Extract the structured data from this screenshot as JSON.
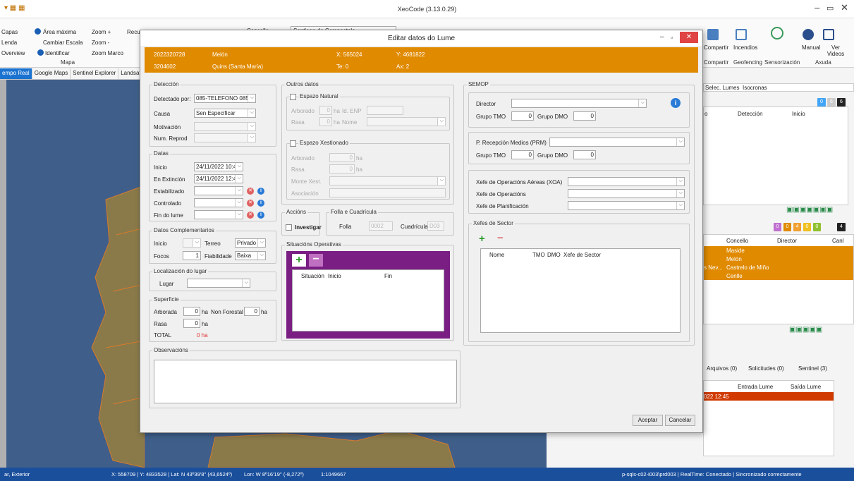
{
  "app": {
    "title": "XeoCode (3.13.0.29)"
  },
  "ribbon": {
    "capas": "Capas",
    "lenda": "Lenda",
    "overview": "Overview",
    "area_maxima": "Área máxima",
    "cambiar_escala": "Cambiar Escala",
    "identificar": "Identificar",
    "zoom_plus": "Zoom +",
    "zoom_minus": "Zoom -",
    "zoom_marco": "Zoom Marco",
    "recursos": "Recursos",
    "mapa": "Mapa",
    "concello_label": "Concello",
    "concello_value": "Santiago de Compostela",
    "compartir": "Compartir",
    "incendios": "Incendios",
    "manual": "Manual",
    "ver_videos": "Ver Videos",
    "grp_compartir": "Compartir",
    "grp_geofencing": "Geofencing",
    "grp_sensorizacion": "Sensorización",
    "grp_axuda": "Axuda"
  },
  "map_tabs": [
    "empo Real",
    "Google Maps",
    "Sentinel Explorer",
    "Landsat Ex"
  ],
  "right_pane": {
    "tabs": [
      "Selec. Lumes",
      "Isocronas"
    ],
    "top_headers": [
      "o",
      "Detección",
      "Inicio"
    ],
    "top_counts": [
      "0",
      "6",
      "6"
    ],
    "mid_counts": [
      "0",
      "0",
      "4",
      "0",
      "0",
      "4"
    ],
    "mid_headers": [
      "Concello",
      "Director",
      "Canl"
    ],
    "rows": [
      [
        "",
        "Maside"
      ],
      [
        "",
        "Melón"
      ],
      [
        "s Nev...",
        "Castrelo de Miño"
      ],
      [
        "",
        "Cenlle"
      ]
    ],
    "bottom_tabs": [
      "Arquivos (0)",
      "Solicitudes (0)",
      "Sentinel (3)"
    ],
    "bottom_headers": [
      "Entrada Lume",
      "Saída Lume"
    ],
    "bottom_row": [
      "022 12:45",
      "",
      ""
    ]
  },
  "status": {
    "left": "ar, Exterior",
    "coords": "X: 558709 | Y: 4833528 | Lat: N 43º39'8'' (43,6524º)",
    "lon": "Lon: W 8º16'19'' (-8,272º)",
    "scale": "1:1049667",
    "right": "p-sqls-c02-i003\\prd003 | RealTime: Conectado | Sincronizado correctamente"
  },
  "dialog": {
    "title": "Editar datos do Lume",
    "header": {
      "id1": "2022320728",
      "name": "Melón",
      "x": "X: 565024",
      "y": "Y: 4681822",
      "id2": "3204602",
      "place": "Quins (Santa María)",
      "te": "Te: 0",
      "ax": "Ax: 2"
    },
    "deteccion": {
      "title": "Detección",
      "detectado_label": "Detectado por:",
      "detectado_value": "085-TELEFONO 085",
      "causa_label": "Causa",
      "causa_value": "Sen Especificar",
      "motivacion_label": "Motivación",
      "num_reprod_label": "Num. Reprod"
    },
    "datas": {
      "title": "Datas",
      "inicio_label": "Inicio",
      "inicio_value": "24/11/2022 10:45",
      "extincion_label": "En Extinción",
      "extincion_value": "24/11/2022 12:46",
      "estabilizado_label": "Estabilizado",
      "controlado_label": "Controlado",
      "fin_label": "Fin do lume"
    },
    "complementarios": {
      "title": "Datos Complementarios",
      "inicio_label": "Inicio",
      "terreo_label": "Terreo",
      "terreo_value": "Privado",
      "focos_label": "Focos",
      "focos_value": "1",
      "fiabilidade_label": "Fiabilidade",
      "fiabilidade_value": "Baixa"
    },
    "localizacion": {
      "title": "Localización do lugar",
      "lugar_label": "Lugar"
    },
    "superficie": {
      "title": "Superficie",
      "arborada_label": "Arborada",
      "arborada_value": "0",
      "ha1": "ha",
      "non_forestal_label": "Non Forestal",
      "non_forestal_value": "0",
      "ha2": "ha",
      "rasa_label": "Rasa",
      "rasa_value": "0",
      "ha3": "ha",
      "total_label": "TOTAL",
      "total_value": "0 ha"
    },
    "observacions": {
      "title": "Observacións"
    },
    "outros": {
      "title": "Outros datos",
      "espazo_natural": "Espazo Natural",
      "arborado_label": "Arborado",
      "arborado_value": "0",
      "ha": "ha",
      "id_enp": "Id. ENP",
      "rasa_label": "Rasa",
      "rasa_value": "0",
      "nome_label": "Nome",
      "espazo_xestionado": "Espazo Xestionado",
      "x_arborado_label": "Arborado",
      "x_arborado_value": "0",
      "x_rasa_label": "Rasa",
      "x_rasa_value": "0",
      "monte_label": "Monte Xest.",
      "asociacion_label": "Asociación"
    },
    "accions": {
      "title": "Accións",
      "investigar": "Investigar"
    },
    "folla": {
      "title": "Folla e Cuadrícula",
      "folla_label": "Folla",
      "folla_value": "0002",
      "cuadricula_label": "Cuadrícula",
      "cuadricula_value": "D03"
    },
    "situacions": {
      "title": "Situacións Operativas",
      "cols": [
        "Situación",
        "Inicio",
        "Fin"
      ]
    },
    "semop": {
      "title": "SEMOP",
      "director_label": "Director",
      "grupo_tmo_label": "Grupo TMO",
      "grupo_tmo_value": "0",
      "grupo_dmo_label": "Grupo DMO",
      "grupo_dmo_value": "0",
      "prm_label": "P. Recepción Medios (PRM)",
      "prm_tmo_label": "Grupo TMO",
      "prm_tmo_value": "0",
      "prm_dmo_label": "Grupo DMO",
      "prm_dmo_value": "0",
      "xoa_label": "Xefe de Operacións Aéreas (XOA)",
      "xefe_op_label": "Xefe de Operacións",
      "xefe_plan_label": "Xefe de Planificación"
    },
    "sector": {
      "title": "Xefes de Sector",
      "cols": [
        "Nome",
        "TMO",
        "DMO",
        "Xefe de Sector"
      ]
    },
    "aceptar": "Aceptar",
    "cancelar": "Cancelar"
  }
}
